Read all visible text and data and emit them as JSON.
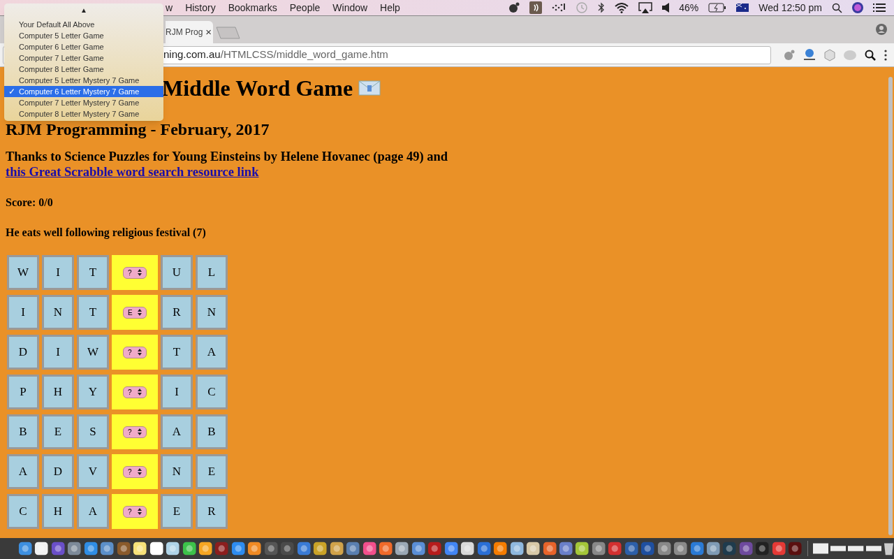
{
  "menu_bar": {
    "items": [
      "w",
      "History",
      "Bookmarks",
      "People",
      "Window",
      "Help"
    ],
    "battery": "46%",
    "clock": "Wed 12:50 pm"
  },
  "tab": {
    "title": "RJM Prog",
    "close": "×"
  },
  "address_bar": {
    "host": "ning.com.au",
    "path": "/HTMLCSS/middle_word_game.htm"
  },
  "dropdown": {
    "scroll_arrow": "▲",
    "check": "✓",
    "options": [
      {
        "label": "Your Default All Above",
        "selected": false
      },
      {
        "label": "Computer 5 Letter Game",
        "selected": false
      },
      {
        "label": "Computer 6 Letter Game",
        "selected": false
      },
      {
        "label": "Computer 7 Letter Game",
        "selected": false
      },
      {
        "label": "Computer 8 Letter Game",
        "selected": false
      },
      {
        "label": "Computer 5 Letter Mystery 7 Game",
        "selected": false
      },
      {
        "label": "Computer 6 Letter Mystery 7 Game",
        "selected": true
      },
      {
        "label": "Computer 7 Letter Mystery 7 Game",
        "selected": false
      },
      {
        "label": "Computer 8 Letter Mystery 7 Game",
        "selected": false
      }
    ]
  },
  "page": {
    "title": "Middle Word Game",
    "subtitle": "RJM Programming - February, 2017",
    "thanks": "Thanks to Science Puzzles for Young Einsteins by Helene Hovanec (page 49) and",
    "link": "this Great Scrabble word search resource link",
    "score": "Score: 0/0",
    "clue": "He eats well following religious festival (7)"
  },
  "grid": [
    {
      "cells": [
        {
          "kind": "letter",
          "text": "W"
        },
        {
          "kind": "letter",
          "text": "I"
        },
        {
          "kind": "letter",
          "text": "T"
        },
        {
          "kind": "select",
          "text": "?"
        },
        {
          "kind": "letter",
          "text": "U"
        },
        {
          "kind": "letter",
          "text": "L"
        }
      ]
    },
    {
      "cells": [
        {
          "kind": "letter",
          "text": "I"
        },
        {
          "kind": "letter",
          "text": "N"
        },
        {
          "kind": "letter",
          "text": "T"
        },
        {
          "kind": "select",
          "text": "E"
        },
        {
          "kind": "letter",
          "text": "R"
        },
        {
          "kind": "letter",
          "text": "N"
        }
      ]
    },
    {
      "cells": [
        {
          "kind": "letter",
          "text": "D"
        },
        {
          "kind": "letter",
          "text": "I"
        },
        {
          "kind": "letter",
          "text": "W"
        },
        {
          "kind": "select",
          "text": "?"
        },
        {
          "kind": "letter",
          "text": "T"
        },
        {
          "kind": "letter",
          "text": "A"
        }
      ]
    },
    {
      "cells": [
        {
          "kind": "letter",
          "text": "P"
        },
        {
          "kind": "letter",
          "text": "H"
        },
        {
          "kind": "letter",
          "text": "Y"
        },
        {
          "kind": "select",
          "text": "?"
        },
        {
          "kind": "letter",
          "text": "I"
        },
        {
          "kind": "letter",
          "text": "C"
        }
      ]
    },
    {
      "cells": [
        {
          "kind": "letter",
          "text": "B"
        },
        {
          "kind": "letter",
          "text": "E"
        },
        {
          "kind": "letter",
          "text": "S"
        },
        {
          "kind": "select",
          "text": "?"
        },
        {
          "kind": "letter",
          "text": "A"
        },
        {
          "kind": "letter",
          "text": "B"
        }
      ]
    },
    {
      "cells": [
        {
          "kind": "letter",
          "text": "A"
        },
        {
          "kind": "letter",
          "text": "D"
        },
        {
          "kind": "letter",
          "text": "V"
        },
        {
          "kind": "select",
          "text": "?"
        },
        {
          "kind": "letter",
          "text": "N"
        },
        {
          "kind": "letter",
          "text": "E"
        }
      ]
    },
    {
      "cells": [
        {
          "kind": "letter",
          "text": "C"
        },
        {
          "kind": "letter",
          "text": "H"
        },
        {
          "kind": "letter",
          "text": "A"
        },
        {
          "kind": "select",
          "text": "?"
        },
        {
          "kind": "letter",
          "text": "E"
        },
        {
          "kind": "letter",
          "text": "R"
        }
      ]
    }
  ]
}
